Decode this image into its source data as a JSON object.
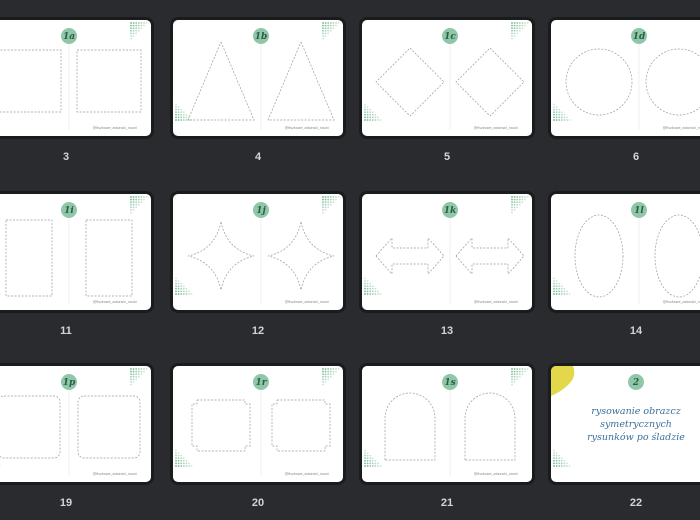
{
  "pages": [
    {
      "number": "3",
      "badge": "1a",
      "footer": "@fiszkowe_zabawki_nauki",
      "shape": "rect-pair"
    },
    {
      "number": "4",
      "badge": "1b",
      "footer": "@fiszkowe_zabawki_nauki",
      "shape": "triangle-pair"
    },
    {
      "number": "5",
      "badge": "1c",
      "footer": "@fiszkowe_zabawki_nauki",
      "shape": "diamond-pair"
    },
    {
      "number": "6",
      "badge": "1d",
      "footer": "@fiszkowe_zabawki_nauki",
      "shape": "circle-pair"
    },
    {
      "number": "11",
      "badge": "1i",
      "footer": "@fiszkowe_zabawki_nauki",
      "shape": "tall-rect-pair"
    },
    {
      "number": "12",
      "badge": "1j",
      "footer": "@fiszkowe_zabawki_nauki",
      "shape": "star-pair"
    },
    {
      "number": "13",
      "badge": "1k",
      "footer": "@fiszkowe_zabawki_nauki",
      "shape": "arrow-pair"
    },
    {
      "number": "14",
      "badge": "1l",
      "footer": "@fiszkowe_zabawki_nauki",
      "shape": "oval-pair"
    },
    {
      "number": "19",
      "badge": "1p",
      "footer": "@fiszkowe_zabawki_nauki",
      "shape": "rounded-rect-pair"
    },
    {
      "number": "20",
      "badge": "1r",
      "footer": "@fiszkowe_zabawki_nauki",
      "shape": "notched-rect-pair"
    },
    {
      "number": "21",
      "badge": "1s",
      "footer": "@fiszkowe_zabawki_nauki",
      "shape": "arch-pair"
    },
    {
      "number": "22",
      "badge": "2",
      "footer": "",
      "shape": "title",
      "title_lines": [
        "rysowanie obrazcz",
        "symetrycznych",
        "rysunków po śladzie"
      ]
    }
  ],
  "colors": {
    "badge": "#8fc7a8",
    "dots": "#4fa873",
    "dash": "#9a9a9a",
    "accent": "#e2d84a"
  }
}
